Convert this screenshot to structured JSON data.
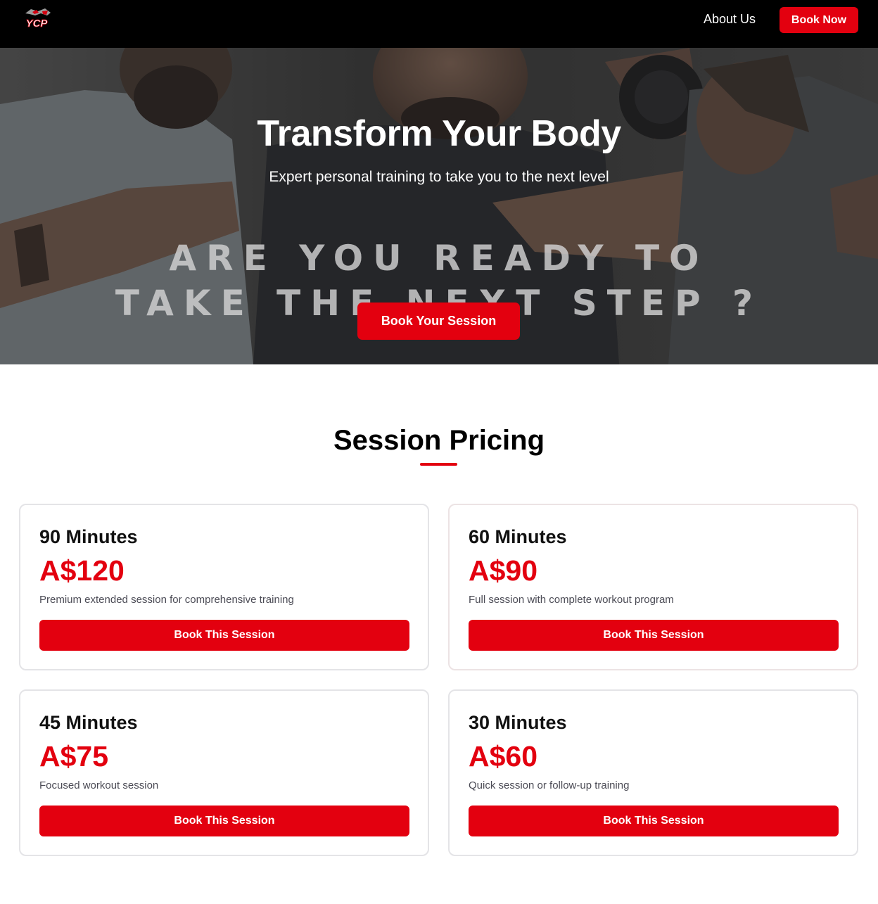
{
  "header": {
    "logo_text": "YCP",
    "nav": {
      "about_label": "About Us"
    },
    "book_now_label": "Book Now"
  },
  "hero": {
    "title": "Transform Your Body",
    "subtitle": "Expert personal training to take you to the next level",
    "image_text_line1": "ARE YOU READY TO",
    "image_text_line2": "TAKE THE NEXT STEP ?",
    "cta_label": "Book Your Session"
  },
  "pricing": {
    "title": "Session Pricing",
    "cards": [
      {
        "duration": "90 Minutes",
        "price": "A$120",
        "description": "Premium extended session for comprehensive training",
        "button_label": "Book This Session"
      },
      {
        "duration": "60 Minutes",
        "price": "A$90",
        "description": "Full session with complete workout program",
        "button_label": "Book This Session"
      },
      {
        "duration": "45 Minutes",
        "price": "A$75",
        "description": "Focused workout session",
        "button_label": "Book This Session"
      },
      {
        "duration": "30 Minutes",
        "price": "A$60",
        "description": "Quick session or follow-up training",
        "button_label": "Book This Session"
      }
    ]
  },
  "colors": {
    "accent": "#e3000f",
    "header_bg": "#000000",
    "card_border": "#e4e4e7"
  },
  "icons": {
    "logo": "ycp-logo"
  }
}
